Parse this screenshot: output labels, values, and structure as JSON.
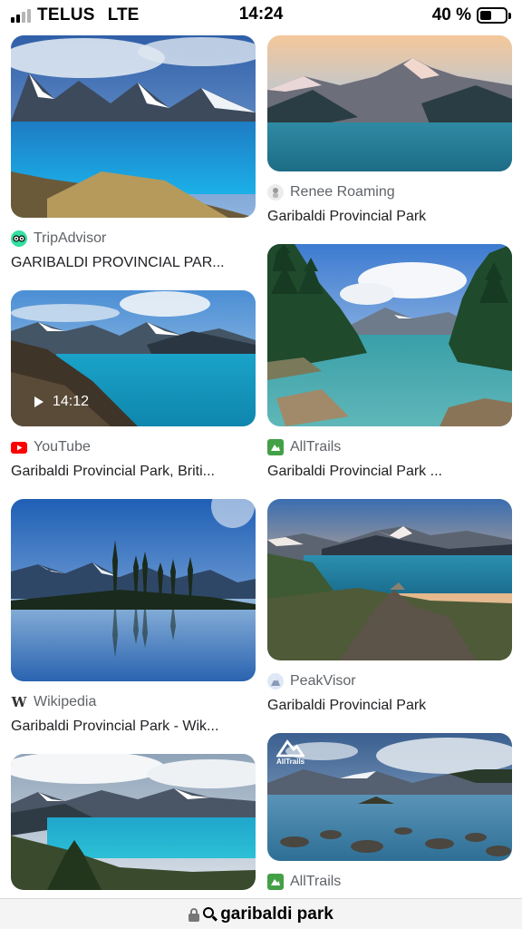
{
  "status_bar": {
    "carrier": "TELUS",
    "network": "LTE",
    "time": "14:24",
    "battery": "40 %",
    "battery_level": 0.4,
    "signal_bars": 2
  },
  "results": [
    {
      "source": "TripAdvisor",
      "source_icon": "tripadvisor-owl-icon",
      "title": "GARIBALDI PROVINCIAL PAR..."
    },
    {
      "source": "Renee Roaming",
      "source_icon": "renee-roaming-favicon",
      "title": "Garibaldi Provincial Park"
    },
    {
      "source": "YouTube",
      "source_icon": "youtube-icon",
      "title": "Garibaldi Provincial Park, Briti...",
      "duration": "14:12"
    },
    {
      "source": "AllTrails",
      "source_icon": "alltrails-icon",
      "title": "Garibaldi Provincial Park ..."
    },
    {
      "source": "Wikipedia",
      "source_icon": "wikipedia-icon",
      "title": "Garibaldi Provincial Park - Wik..."
    },
    {
      "source": "PeakVisor",
      "source_icon": "peakvisor-icon",
      "title": "Garibaldi Provincial Park"
    },
    {
      "source": "AllTrails",
      "source_icon": "alltrails-icon",
      "title": "",
      "watermark": "AllTrails"
    }
  ],
  "search": {
    "query": "garibaldi park"
  },
  "colors": {
    "lake": "#2ba0c8",
    "youtube": "#ff0000",
    "alltrails": "#43a047",
    "tripadvisor": "#34e0a1"
  }
}
